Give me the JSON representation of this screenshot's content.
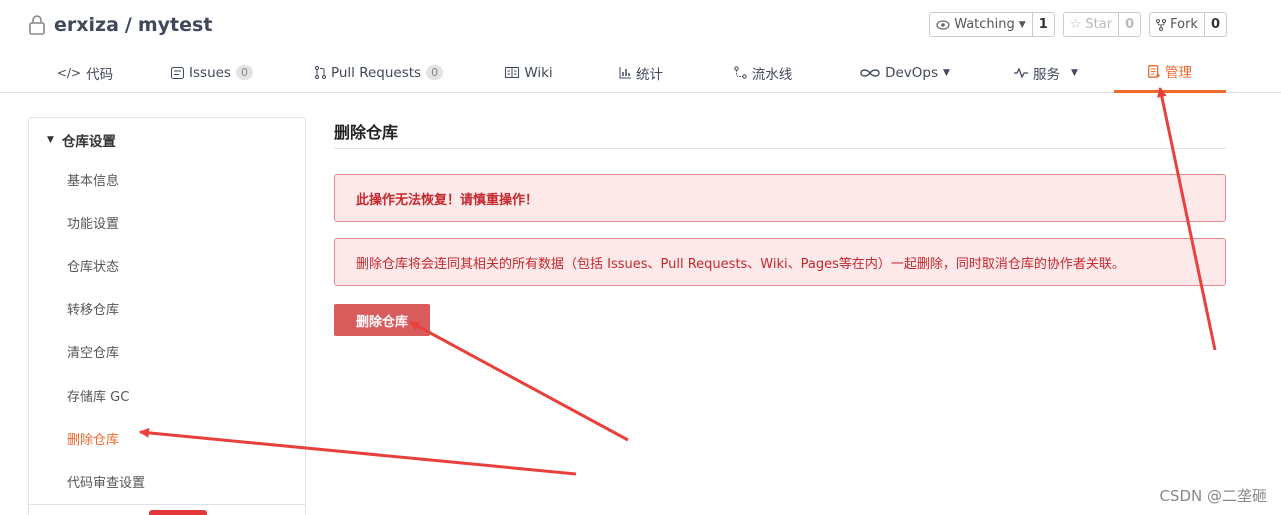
{
  "repo": {
    "owner": "erxiza",
    "separator": "/",
    "name": "mytest"
  },
  "actions": {
    "watch": {
      "label": "Watching",
      "count": "1"
    },
    "star": {
      "label": "Star",
      "count": "0"
    },
    "fork": {
      "label": "Fork",
      "count": "0"
    }
  },
  "tabs": [
    {
      "label": "代码",
      "icon": "code-icon"
    },
    {
      "label": "Issues",
      "badge": "0",
      "icon": "issues-icon"
    },
    {
      "label": "Pull Requests",
      "badge": "0",
      "icon": "pull-request-icon"
    },
    {
      "label": "Wiki",
      "icon": "wiki-icon"
    },
    {
      "label": "统计",
      "icon": "stats-icon"
    },
    {
      "label": "流水线",
      "icon": "pipeline-icon"
    },
    {
      "label": "DevOps",
      "icon": "devops-icon"
    },
    {
      "label": "服务",
      "icon": "service-icon"
    },
    {
      "label": "管理",
      "icon": "manage-icon",
      "active": true
    }
  ],
  "sidebar": {
    "heading": "仓库设置",
    "items": [
      {
        "label": "基本信息"
      },
      {
        "label": "功能设置"
      },
      {
        "label": "仓库状态"
      },
      {
        "label": "转移仓库"
      },
      {
        "label": "清空仓库"
      },
      {
        "label": "存储库 GC"
      },
      {
        "label": "删除仓库",
        "active": true
      },
      {
        "label": "代码审查设置"
      }
    ]
  },
  "main": {
    "title": "删除仓库",
    "warning": "此操作无法恢复！请慎重操作！",
    "description": "删除仓库将会连同其相关的所有数据（包括 Issues、Pull Requests、Wiki、Pages等在内）一起删除，同时取消仓库的协作者关联。",
    "delete_button": "删除仓库"
  },
  "watermark": "CSDN @二垄砸",
  "colors": {
    "accent": "#f0692c",
    "danger": "#d95c5c",
    "alert_bg": "#fde9e9",
    "alert_text": "#c4282d",
    "annotation": "#e8403c"
  }
}
